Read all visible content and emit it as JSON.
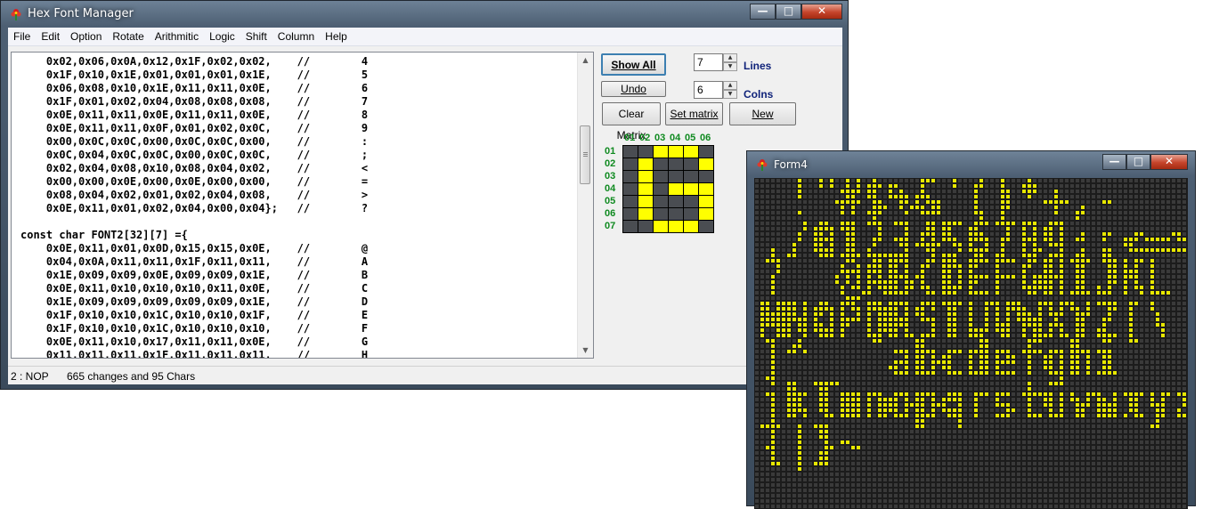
{
  "main_window": {
    "title": "Hex Font Manager",
    "caption": {
      "minimize": "—",
      "maximize": "□",
      "close": "✕"
    }
  },
  "menu": [
    "File",
    "Edit",
    "Option",
    "Rotate",
    "Arithmitic",
    "Logic",
    "Shift",
    "Column",
    "Help"
  ],
  "editor": {
    "lines": [
      "    0x02,0x06,0x0A,0x12,0x1F,0x02,0x02,    //        4",
      "    0x1F,0x10,0x1E,0x01,0x01,0x01,0x1E,    //        5",
      "    0x06,0x08,0x10,0x1E,0x11,0x11,0x0E,    //        6",
      "    0x1F,0x01,0x02,0x04,0x08,0x08,0x08,    //        7",
      "    0x0E,0x11,0x11,0x0E,0x11,0x11,0x0E,    //        8",
      "    0x0E,0x11,0x11,0x0F,0x01,0x02,0x0C,    //        9",
      "    0x00,0x0C,0x0C,0x00,0x0C,0x0C,0x00,    //        :",
      "    0x0C,0x04,0x0C,0x0C,0x00,0x0C,0x0C,    //        ;",
      "    0x02,0x04,0x08,0x10,0x08,0x04,0x02,    //        <",
      "    0x00,0x00,0x0E,0x00,0x0E,0x00,0x00,    //        =",
      "    0x08,0x04,0x02,0x01,0x02,0x04,0x08,    //        >",
      "    0x0E,0x11,0x01,0x02,0x04,0x00,0x04};   //        ?",
      "",
      "const char FONT2[32][7] ={",
      "    0x0E,0x11,0x01,0x0D,0x15,0x15,0x0E,    //        @",
      "    0x04,0x0A,0x11,0x11,0x1F,0x11,0x11,    //        A",
      "    0x1E,0x09,0x09,0x0E,0x09,0x09,0x1E,    //        B",
      "    0x0E,0x11,0x10,0x10,0x10,0x11,0x0E,    //        C",
      "    0x1E,0x09,0x09,0x09,0x09,0x09,0x1E,    //        D",
      "    0x1F,0x10,0x10,0x1C,0x10,0x10,0x1F,    //        E",
      "    0x1F,0x10,0x10,0x1C,0x10,0x10,0x10,    //        F",
      "    0x0E,0x11,0x10,0x17,0x11,0x11,0x0E,    //        G",
      "    0x11,0x11,0x11,0x1F,0x11,0x11,0x11,    //        H"
    ]
  },
  "status": {
    "cursor": "2 : NOP",
    "summary": "665 changes and 95 Chars"
  },
  "controls": {
    "show_all": "Show All",
    "undo": "Undo",
    "clear_matrix": "Clear Matrix",
    "set_matrix": "Set matrix",
    "new": "New",
    "lines_value": "7",
    "lines_label": "Lines",
    "colns_value": "6",
    "colns_label": "Colns"
  },
  "matrix": {
    "col_labels": [
      "01",
      "02",
      "03",
      "04",
      "05",
      "06"
    ],
    "row_labels": [
      "01",
      "02",
      "03",
      "04",
      "05",
      "06",
      "07"
    ],
    "on_color": "#ffff00",
    "off_color": "#4a4d52",
    "pattern": [
      "001110",
      "010001",
      "010000",
      "010111",
      "010001",
      "010001",
      "001110"
    ]
  },
  "form4": {
    "title": "Form4",
    "caption": {
      "minimize": "—",
      "maximize": "□",
      "close": "✕"
    },
    "led_on": "#e8e800",
    "led_off": "#3a3a3a",
    "text_rows": [
      " !\"#$%&'()*+,-",
      "./0123456789:;<=>",
      "?  @ABCDEFGHIJKL",
      "MNOPQRSTUVWXYZ[\\",
      "]^_ `abcdefghi",
      "jklmnopqrstuvwxyz",
      "{|}~"
    ]
  }
}
